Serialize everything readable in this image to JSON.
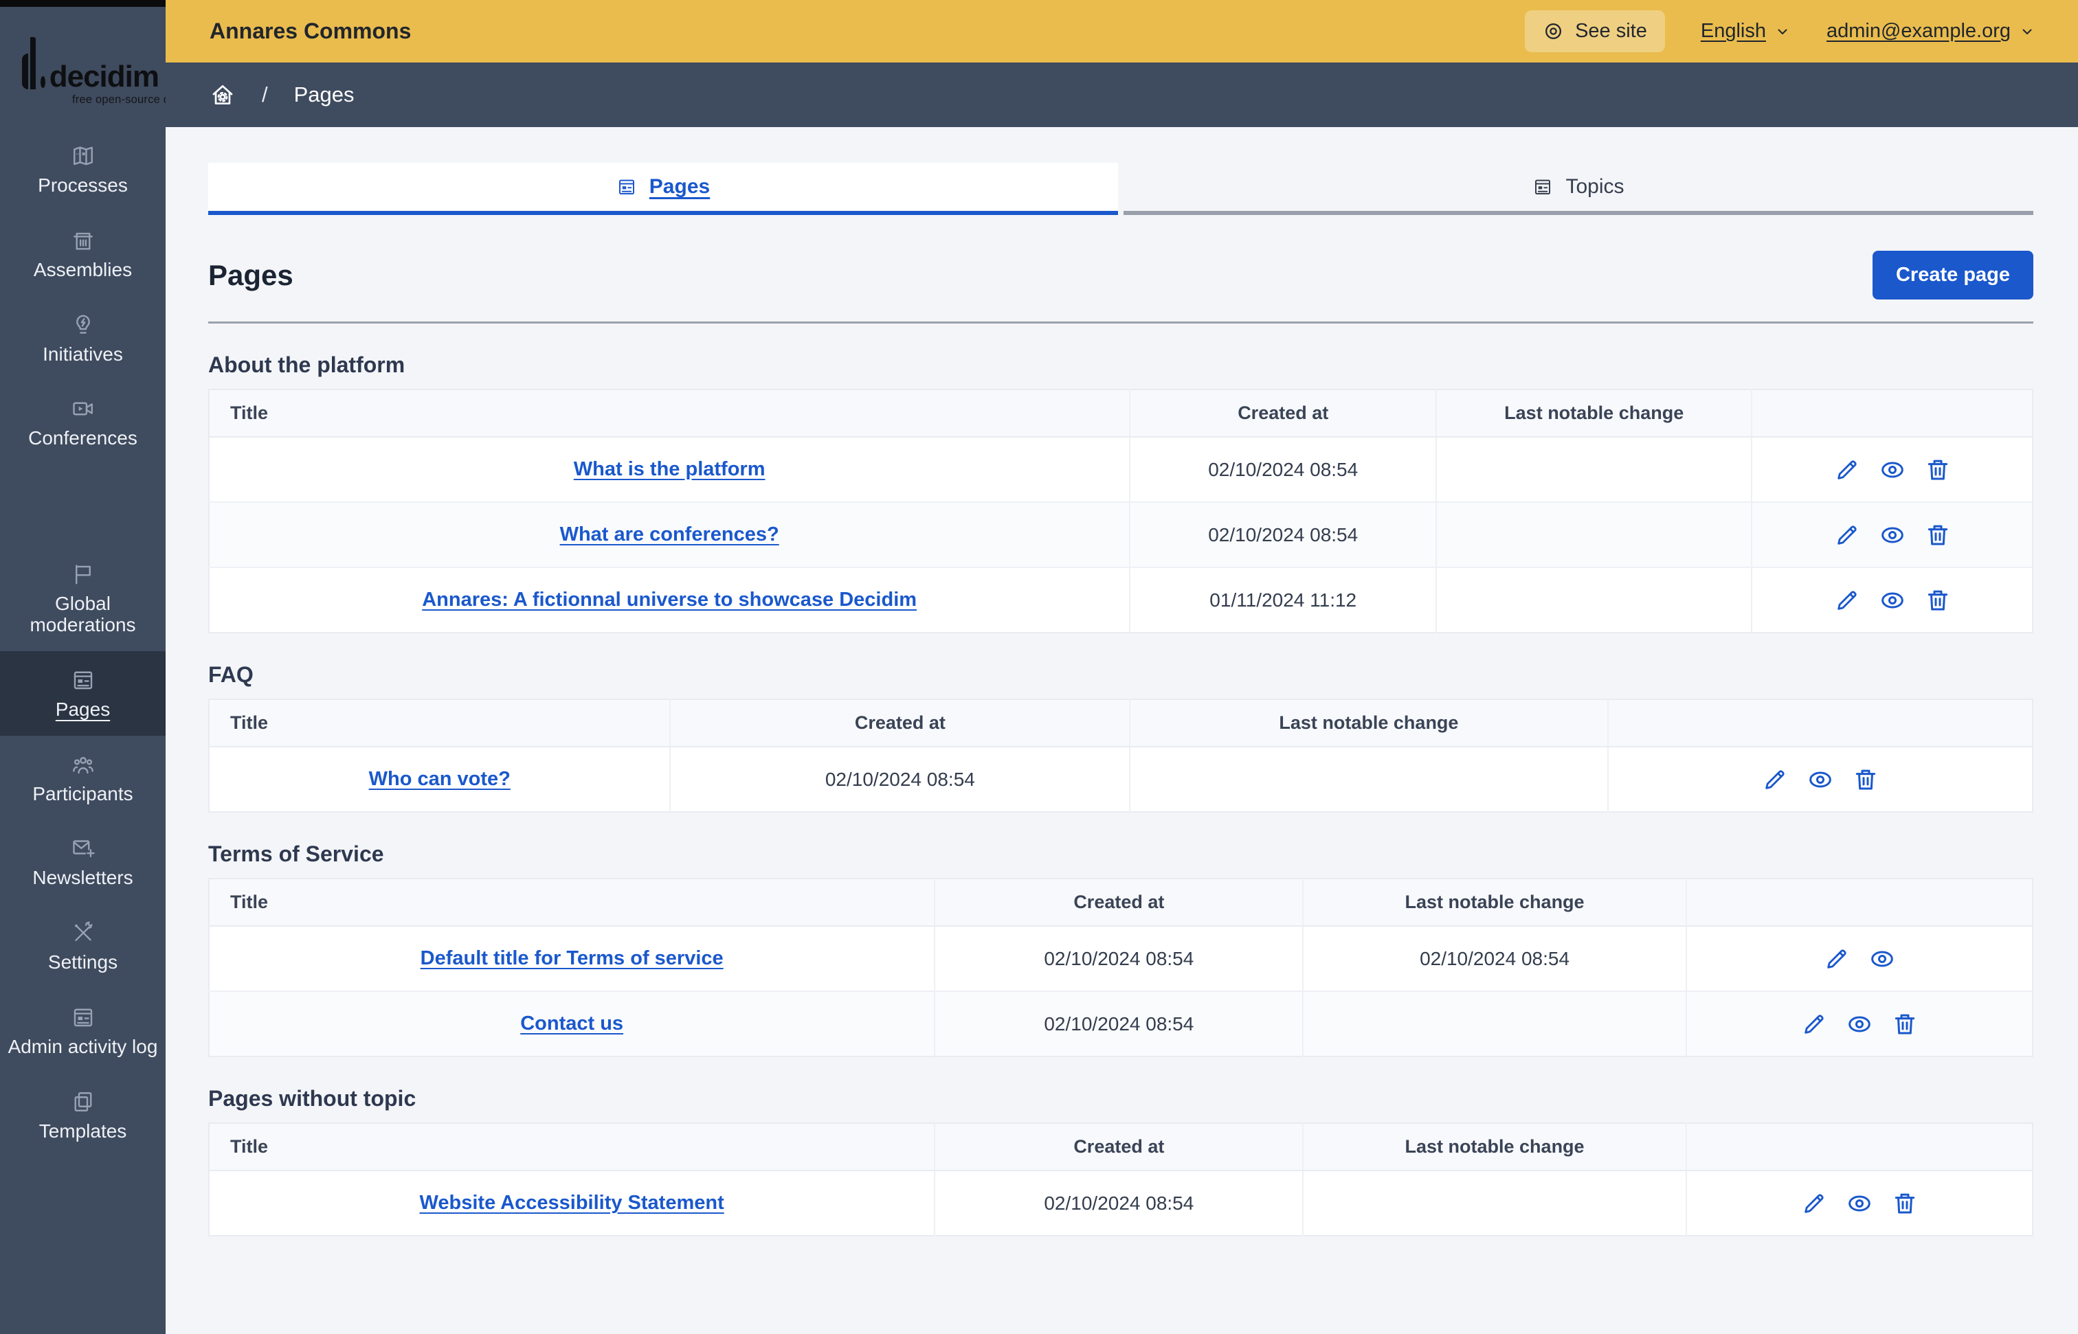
{
  "brand": {
    "name": "decidim",
    "tagline": "free open-source democracy"
  },
  "topbar": {
    "organization": "Annares Commons",
    "see_site_label": "See site",
    "language_label": "English",
    "user_email": "admin@example.org"
  },
  "breadcrumb": {
    "separator": "/",
    "current": "Pages"
  },
  "sidebar": {
    "groups": [
      {
        "items": [
          {
            "label": "Processes",
            "icon": "treasure-map-icon"
          },
          {
            "label": "Assemblies",
            "icon": "bank-building-icon"
          },
          {
            "label": "Initiatives",
            "icon": "lightbulb-flash-icon"
          },
          {
            "label": "Conferences",
            "icon": "video-camera-icon"
          }
        ]
      },
      {
        "items": [
          {
            "label": "Global moderations",
            "icon": "flag-icon"
          },
          {
            "label": "Pages",
            "icon": "article-window-icon",
            "active": true
          },
          {
            "label": "Participants",
            "icon": "people-group-icon"
          },
          {
            "label": "Newsletters",
            "icon": "mail-add-icon"
          },
          {
            "label": "Settings",
            "icon": "tools-icon"
          },
          {
            "label": "Admin activity log",
            "icon": "article-window-icon"
          },
          {
            "label": "Templates",
            "icon": "file-copy-icon"
          }
        ]
      }
    ]
  },
  "tabs": {
    "pages_label": "Pages",
    "topics_label": "Topics"
  },
  "page": {
    "title": "Pages",
    "create_button": "Create page"
  },
  "sections": [
    {
      "title": "About the platform",
      "headers": {
        "col_title": "Title",
        "col_created": "Created at",
        "col_change": "Last notable change"
      },
      "rows": [
        {
          "title": "What is the platform",
          "created_at": "02/10/2024 08:54",
          "last_notable_change": "",
          "actions": [
            "edit",
            "preview",
            "delete"
          ]
        },
        {
          "title": "What are conferences?",
          "created_at": "02/10/2024 08:54",
          "last_notable_change": "",
          "actions": [
            "edit",
            "preview",
            "delete"
          ]
        },
        {
          "title": "Annares: A fictionnal universe to showcase Decidim",
          "created_at": "01/11/2024 11:12",
          "last_notable_change": "",
          "actions": [
            "edit",
            "preview",
            "delete"
          ]
        }
      ]
    },
    {
      "title": "FAQ",
      "headers": {
        "col_title": "Title",
        "col_created": "Created at",
        "col_change": "Last notable change"
      },
      "rows": [
        {
          "title": "Who can vote?",
          "created_at": "02/10/2024 08:54",
          "last_notable_change": "",
          "actions": [
            "edit",
            "preview",
            "delete"
          ]
        }
      ]
    },
    {
      "title": "Terms of Service",
      "headers": {
        "col_title": "Title",
        "col_created": "Created at",
        "col_change": "Last notable change"
      },
      "rows": [
        {
          "title": "Default title for Terms of service",
          "created_at": "02/10/2024 08:54",
          "last_notable_change": "02/10/2024 08:54",
          "actions": [
            "edit",
            "preview"
          ]
        },
        {
          "title": "Contact us",
          "created_at": "02/10/2024 08:54",
          "last_notable_change": "",
          "actions": [
            "edit",
            "preview",
            "delete"
          ]
        }
      ]
    },
    {
      "title": "Pages without topic",
      "headers": {
        "col_title": "Title",
        "col_created": "Created at",
        "col_change": "Last notable change"
      },
      "rows": [
        {
          "title": "Website Accessibility Statement",
          "created_at": "02/10/2024 08:54",
          "last_notable_change": "",
          "actions": [
            "edit",
            "preview",
            "delete"
          ]
        }
      ]
    }
  ],
  "colors": {
    "accent_blue": "#1a58cc",
    "topbar_yellow": "#e9bc4d",
    "sidebar_slate": "#3f4b5e",
    "sidebar_selected": "#2a3442",
    "content_bg": "#f4f5f8"
  }
}
